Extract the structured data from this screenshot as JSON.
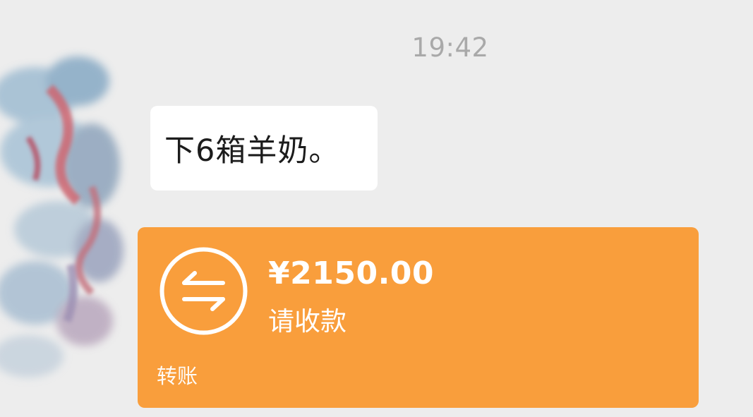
{
  "chat": {
    "timestamp": "19:42",
    "messages": [
      {
        "type": "text",
        "text": "下6箱羊奶。"
      },
      {
        "type": "transfer",
        "amount": "¥2150.00",
        "status": "请收款",
        "label": "转账",
        "icon": "transfer-arrows-icon"
      }
    ]
  },
  "colors": {
    "background": "#ededed",
    "bubble": "#ffffff",
    "transfer_card": "#f99e3c",
    "timestamp": "#a9a9a9"
  }
}
